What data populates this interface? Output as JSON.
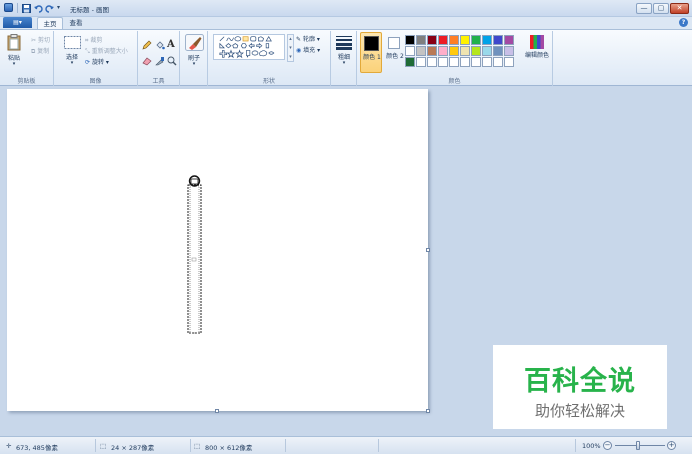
{
  "window": {
    "title": "无标题 - 画图",
    "minimize": "—",
    "maximize": "▢",
    "close": "✕"
  },
  "menu": {
    "app_button": "▤▾",
    "tabs": [
      "主页",
      "查看"
    ],
    "help": "?"
  },
  "ribbon": {
    "clipboard": {
      "label": "剪贴板",
      "paste": "粘贴",
      "cut": "剪切",
      "copy": "复制"
    },
    "image": {
      "label": "图像",
      "select": "选择",
      "crop": "裁剪",
      "resize": "重新调整大小",
      "rotate": "旋转"
    },
    "tools": {
      "label": "工具",
      "icons": [
        "pencil-icon",
        "fill-icon",
        "text-icon",
        "eraser-icon",
        "color-picker-icon",
        "magnifier-icon"
      ]
    },
    "brushes": {
      "label": "刷子"
    },
    "shapes": {
      "label": "形状",
      "outline": "轮廓",
      "fill": "填充"
    },
    "size": {
      "label": "粗细"
    },
    "colors": {
      "label": "颜色",
      "color1_label": "颜色 1",
      "color2_label": "颜色 2",
      "edit_colors": "编辑颜色",
      "color1": "#000000",
      "color2": "#ffffff",
      "palette_row1": [
        "#000000",
        "#7f7f7f",
        "#880015",
        "#ed1c24",
        "#ff7f27",
        "#fff200",
        "#22b14c",
        "#00a2e8",
        "#3f48cc",
        "#a349a4"
      ],
      "palette_row2": [
        "#ffffff",
        "#c3c3c3",
        "#b97a57",
        "#ffaec9",
        "#ffc90e",
        "#efe4b0",
        "#b5e61d",
        "#99d9ea",
        "#7092be",
        "#c8bfe7"
      ],
      "palette_row3_first": "#1f6b36"
    }
  },
  "status": {
    "cursor_pos": "673, 485像素",
    "selection_size": "24 × 287像素",
    "image_size": "800 × 612像素",
    "zoom": "100%"
  },
  "watermark": {
    "title": "百科全说",
    "subtitle": "助你轻松解决"
  }
}
